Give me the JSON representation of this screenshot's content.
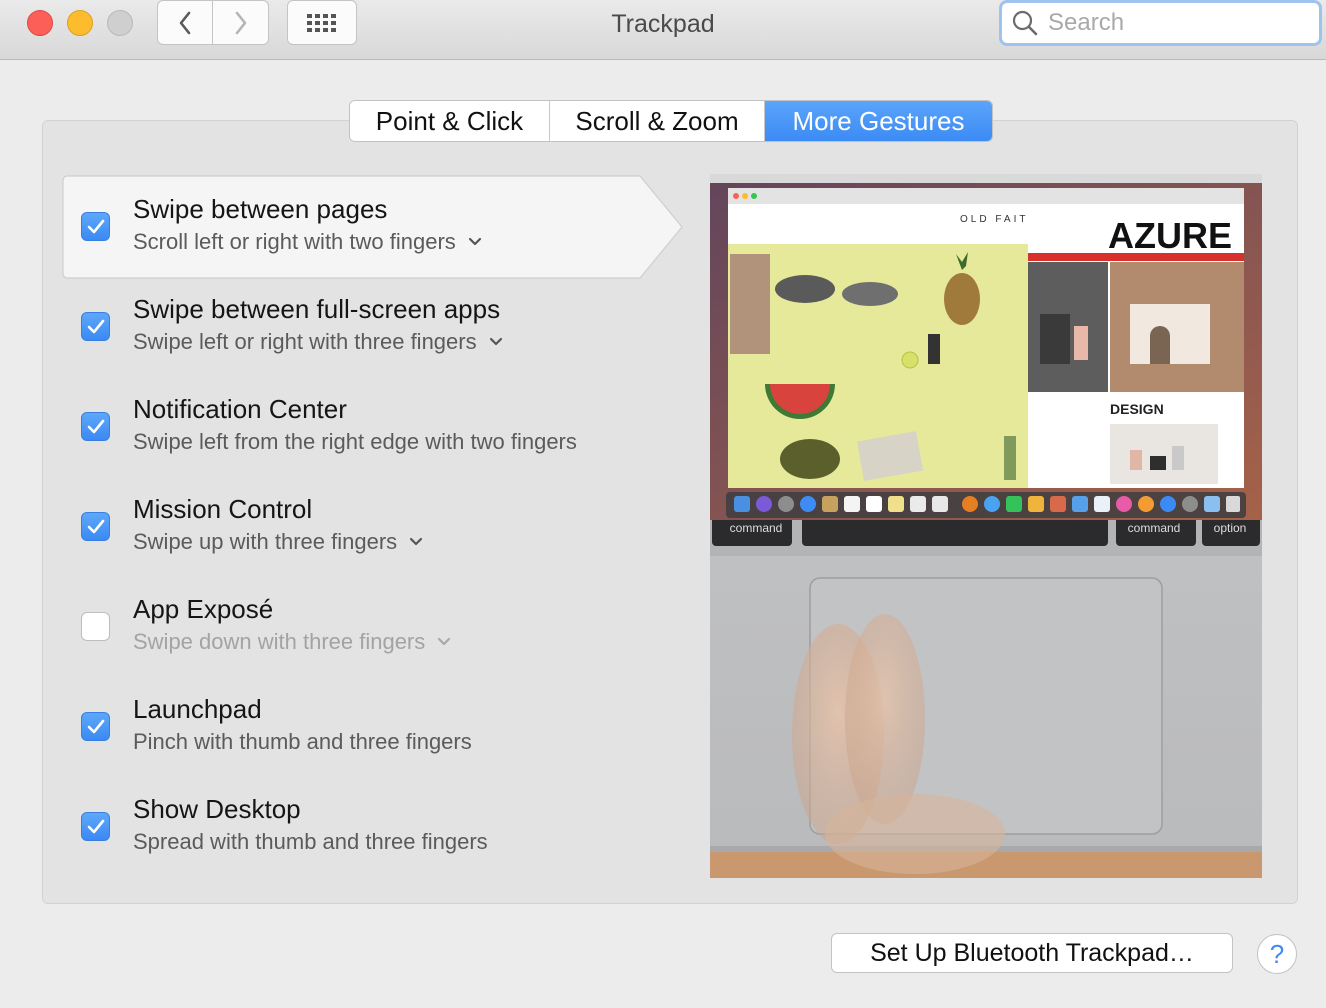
{
  "window": {
    "title": "Trackpad"
  },
  "search": {
    "placeholder": "Search",
    "value": ""
  },
  "tabs": [
    {
      "label": "Point & Click",
      "active": false
    },
    {
      "label": "Scroll & Zoom",
      "active": false
    },
    {
      "label": "More Gestures",
      "active": true
    }
  ],
  "gestures": [
    {
      "title": "Swipe between pages",
      "subtitle": "Scroll left or right with two fingers",
      "checked": true,
      "has_menu": true,
      "selected": true
    },
    {
      "title": "Swipe between full-screen apps",
      "subtitle": "Swipe left or right with three fingers",
      "checked": true,
      "has_menu": true
    },
    {
      "title": "Notification Center",
      "subtitle": "Swipe left from the right edge with two fingers",
      "checked": true,
      "has_menu": false
    },
    {
      "title": "Mission Control",
      "subtitle": "Swipe up with three fingers",
      "checked": true,
      "has_menu": true
    },
    {
      "title": "App Exposé",
      "subtitle": "Swipe down with three fingers",
      "checked": false,
      "has_menu": true
    },
    {
      "title": "Launchpad",
      "subtitle": "Pinch with thumb and three fingers",
      "checked": true,
      "has_menu": false
    },
    {
      "title": "Show Desktop",
      "subtitle": "Spread with thumb and three fingers",
      "checked": true,
      "has_menu": false
    }
  ],
  "preview": {
    "brand_text": "OLD FAITHFUL",
    "magazine_title": "AZURE",
    "section_label": "DESIGN",
    "key_left": "command",
    "key_right": "command",
    "key_option": "option"
  },
  "footer": {
    "bluetooth_button": "Set Up Bluetooth Trackpad…",
    "help": "?"
  },
  "colors": {
    "accent": "#3c8bf5",
    "checkbox_on": "#4a98f7"
  }
}
